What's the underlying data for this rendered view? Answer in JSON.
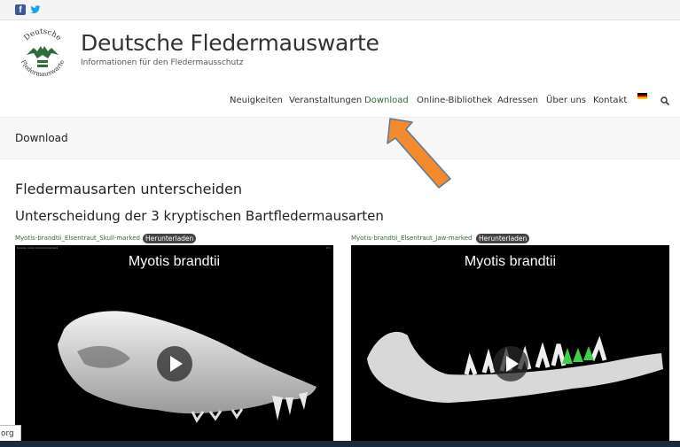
{
  "social": {
    "facebook": "f",
    "twitter": "twitter-icon"
  },
  "site": {
    "title": "Deutsche Fledermauswarte",
    "tagline": "Informationen für den Fledermausschutz",
    "logo_top": "Deutsche",
    "logo_bottom": "Fledermauswarte"
  },
  "nav": [
    "Neuigkeiten",
    "Veranstaltungen",
    "Download",
    "Online-Bibliothek",
    "Adressen",
    "Über uns",
    "Kontakt"
  ],
  "breadcrumb": "Download",
  "content": {
    "heading": "Fledermausarten unterscheiden",
    "subheading": "Unterscheidung der 3 kryptischen Bartfledermausarten"
  },
  "videos": [
    {
      "file": "Myotis-brandtii_Elsentraut_Skull-marked",
      "button": "Herunterladen",
      "title": "Myotis brandtii",
      "corner_left": "Source: xxxx.xx/xxxxx/xx/xxxx",
      "corner_right": "0:1"
    },
    {
      "file": "Myotis-brandtii_Elsentraut_Jaw-marked",
      "button": "Herunterladen",
      "title": "Myotis brandtii"
    }
  ],
  "status": "org",
  "colors": {
    "accent": "#2f6b3b",
    "arrow": "#f28a2e",
    "badge": "#444444"
  }
}
